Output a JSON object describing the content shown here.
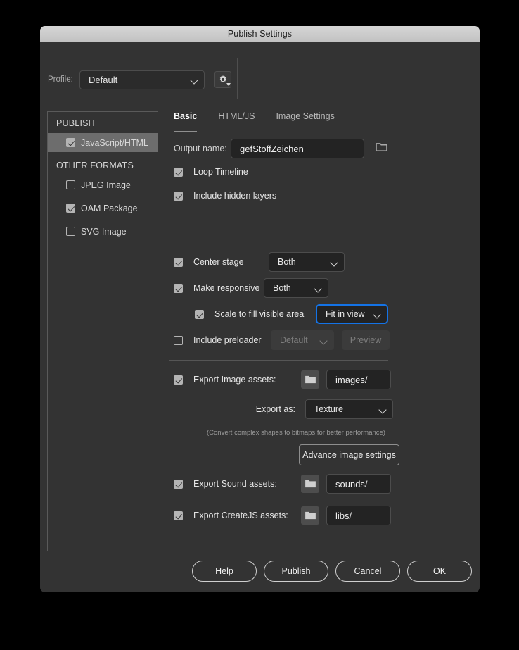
{
  "window": {
    "title": "Publish Settings"
  },
  "profile": {
    "label": "Profile:",
    "value": "Default",
    "gear_icon": "gear-icon",
    "chevron_icon": "chevron-down-icon"
  },
  "sidebar": {
    "groups": [
      {
        "header": "PUBLISH",
        "items": [
          {
            "label": "JavaScript/HTML",
            "checked": true,
            "selected": true
          }
        ]
      },
      {
        "header": "OTHER FORMATS",
        "items": [
          {
            "label": "JPEG Image",
            "checked": false,
            "selected": false
          },
          {
            "label": "OAM Package",
            "checked": true,
            "selected": false
          },
          {
            "label": "SVG Image",
            "checked": false,
            "selected": false
          }
        ]
      }
    ]
  },
  "main": {
    "tabs": [
      {
        "label": "Basic",
        "active": true
      },
      {
        "label": "HTML/JS",
        "active": false
      },
      {
        "label": "Image Settings",
        "active": false
      }
    ],
    "output_name": {
      "label": "Output name:",
      "value": "gefStoffZeichen",
      "browse_icon": "folder-icon"
    },
    "loop_timeline": {
      "label": "Loop Timeline",
      "checked": true
    },
    "include_hidden_layers": {
      "label": "Include hidden layers",
      "checked": true
    },
    "center_stage": {
      "label": "Center stage",
      "checked": true,
      "value": "Both"
    },
    "make_responsive": {
      "label": "Make responsive",
      "checked": true,
      "value": "Both"
    },
    "scale_to_fill": {
      "label": "Scale to fill visible area",
      "checked": true,
      "value": "Fit in view",
      "focused": true
    },
    "include_preloader": {
      "label": "Include preloader",
      "checked": false,
      "value": "Default",
      "preview_label": "Preview"
    },
    "export_image_assets": {
      "label": "Export Image assets:",
      "checked": true,
      "path": "images/",
      "browse_icon": "folder-icon"
    },
    "export_as": {
      "label": "Export as:",
      "value": "Texture"
    },
    "bitmap_note": "(Convert complex shapes to bitmaps for better performance)",
    "advance_image_settings": "Advance image settings",
    "export_sound_assets": {
      "label": "Export Sound assets:",
      "checked": true,
      "path": "sounds/",
      "browse_icon": "folder-icon"
    },
    "export_createjs_assets": {
      "label": "Export CreateJS assets:",
      "checked": true,
      "path": "libs/",
      "browse_icon": "folder-icon"
    }
  },
  "footer": {
    "help": "Help",
    "publish": "Publish",
    "cancel": "Cancel",
    "ok": "OK"
  },
  "colors": {
    "dialog_bg": "#333333",
    "titlebar": "#cccccc",
    "focus_blue": "#1473e6",
    "field_bg": "#232323",
    "selected_row": "#6d6d6d"
  }
}
